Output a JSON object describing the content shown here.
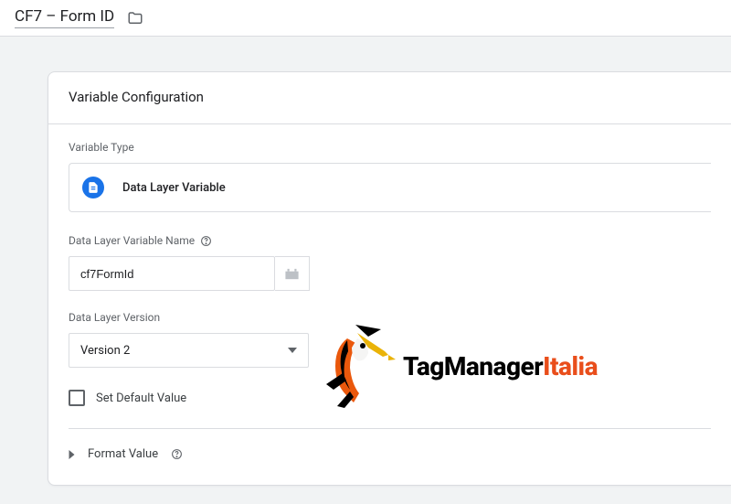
{
  "header": {
    "title": "CF7 – Form ID"
  },
  "config": {
    "panel_title": "Variable Configuration",
    "variable_type_label": "Variable Type",
    "variable_type_value": "Data Layer Variable",
    "dlv_name_label": "Data Layer Variable Name",
    "dlv_name_value": "cf7FormId",
    "dlv_version_label": "Data Layer Version",
    "dlv_version_value": "Version 2",
    "set_default_value_label": "Set Default Value",
    "format_value_label": "Format Value"
  },
  "watermark": {
    "brand_prefix": "TagManager",
    "brand_accent": "Italia"
  }
}
